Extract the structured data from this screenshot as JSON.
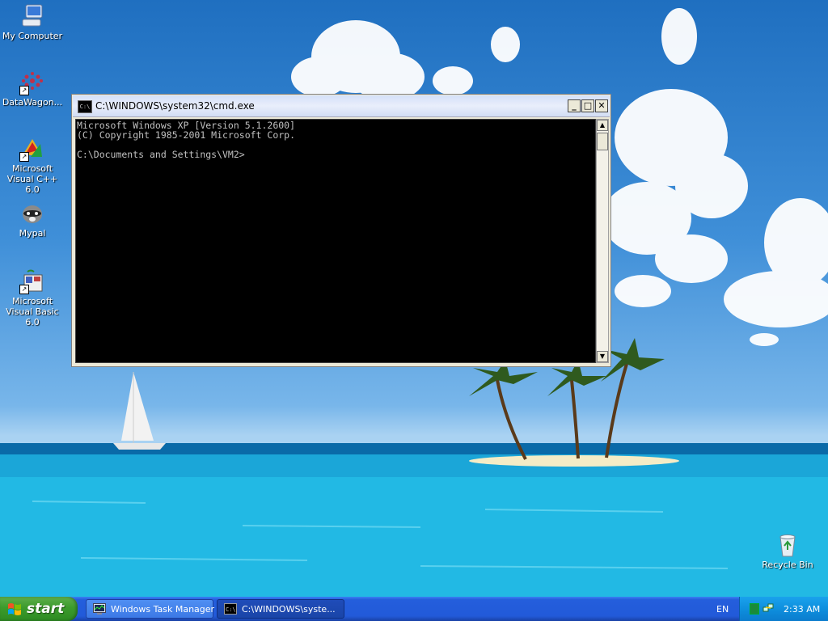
{
  "desktop": {
    "icons": [
      {
        "label": "My Computer",
        "icon": "my-computer-icon"
      },
      {
        "label": "DataWagon...",
        "icon": "datawagon-icon"
      },
      {
        "label": "Microsoft Visual C++ 6.0",
        "icon": "visual-cpp-icon"
      },
      {
        "label": "Mypal",
        "icon": "mypal-icon"
      },
      {
        "label": "Microsoft Visual Basic 6.0",
        "icon": "visual-basic-icon"
      },
      {
        "label": "Recycle Bin",
        "icon": "recycle-bin-icon"
      }
    ]
  },
  "cmd_window": {
    "title": "C:\\WINDOWS\\system32\\cmd.exe",
    "icon_glyph": "C:\\",
    "console_text": "Microsoft Windows XP [Version 5.1.2600]\n(C) Copyright 1985-2001 Microsoft Corp.\n\nC:\\Documents and Settings\\VM2>",
    "minimize_glyph": "_",
    "maximize_glyph": "□",
    "close_glyph": "✕",
    "scroll_up_glyph": "▲",
    "scroll_down_glyph": "▼"
  },
  "taskbar": {
    "start_label": "start",
    "tasks": [
      {
        "label": "Windows Task Manager"
      },
      {
        "label": "C:\\WINDOWS\\syste..."
      }
    ],
    "language": "EN",
    "clock": "2:33 AM"
  },
  "colors": {
    "taskbar_blue": "#245edc",
    "start_green": "#3c9b2c",
    "console_bg": "#000000",
    "console_text": "#c0c0c0",
    "tray_blue": "#0e8fde"
  }
}
